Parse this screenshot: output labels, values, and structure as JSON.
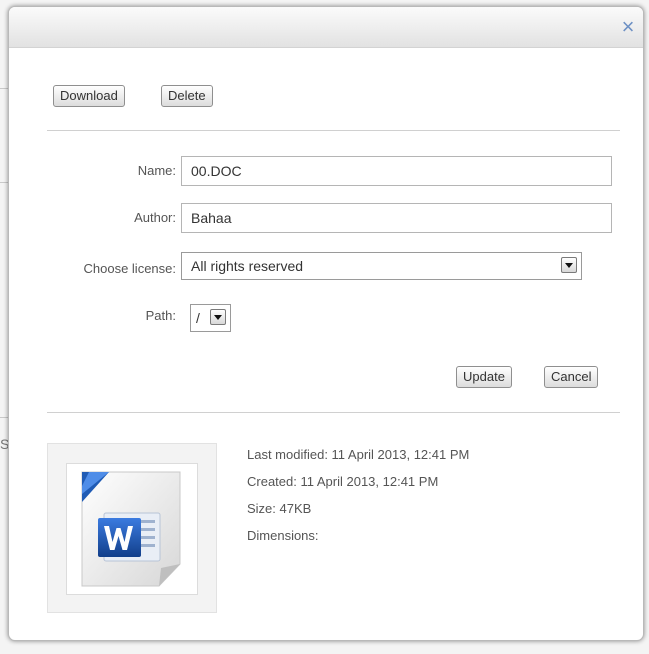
{
  "dialog": {
    "close_symbol": "×",
    "close_icon": "close-icon"
  },
  "toolbar": {
    "download_label": "Download",
    "delete_label": "Delete"
  },
  "form": {
    "name_label": "Name:",
    "name_value": "00.DOC",
    "author_label": "Author:",
    "author_value": "Bahaa",
    "license_label": "Choose license:",
    "license_value": "All rights reserved",
    "path_label": "Path:",
    "path_value": "/"
  },
  "actions": {
    "update_label": "Update",
    "cancel_label": "Cancel"
  },
  "file_info": {
    "thumbnail_icon": "word-document-icon",
    "last_modified": "Last modified: 11 April 2013, 12:41 PM",
    "created": "Created: 11 April 2013, 12:41 PM",
    "size": "Size: 47KB",
    "dimensions": "Dimensions:"
  },
  "background": {
    "fragment_text": "S"
  },
  "colors": {
    "close_icon": "#6d90c4",
    "word_blue": "#1f5bb5",
    "word_dark_blue": "#123f8a"
  }
}
